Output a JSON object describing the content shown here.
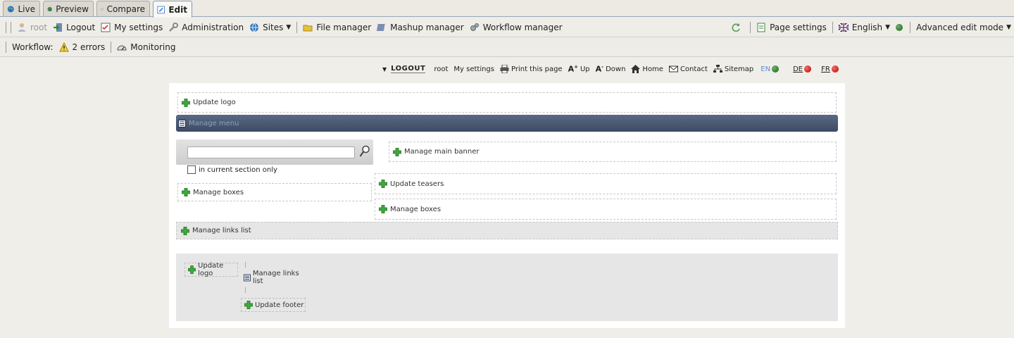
{
  "tabs": [
    {
      "label": "Live",
      "icon": "globe-icon"
    },
    {
      "label": "Preview",
      "icon": "preview-globe-icon"
    },
    {
      "label": "Compare",
      "icon": "compare-icon"
    },
    {
      "label": "Edit",
      "icon": "edit-icon",
      "active": true
    }
  ],
  "toolbar": {
    "user": "root",
    "logout": "Logout",
    "my_settings": "My settings",
    "administration": "Administration",
    "sites": "Sites",
    "file_manager": "File manager",
    "mashup_manager": "Mashup manager",
    "workflow_manager": "Workflow manager",
    "page_settings": "Page settings",
    "language": "English",
    "edit_mode": "Advanced edit mode"
  },
  "workflow": {
    "label": "Workflow:",
    "errors": "2 errors",
    "monitoring": "Monitoring"
  },
  "site_links": {
    "logout": "LOGOUT",
    "user": "root",
    "my_settings": "My settings",
    "print": "Print this page",
    "font_up": "Up",
    "font_down": "Down",
    "home": "Home",
    "contact": "Contact",
    "sitemap": "Sitemap",
    "languages": [
      {
        "code": "EN",
        "status": "green"
      },
      {
        "code": "DE",
        "status": "red"
      },
      {
        "code": "FR",
        "status": "red"
      }
    ]
  },
  "page": {
    "update_logo": "Update logo",
    "manage_menu": "Manage menu",
    "search_placeholder": "",
    "search_scope": "in current section only",
    "manage_main_banner": "Manage main banner",
    "manage_boxes_left": "Manage boxes",
    "update_teasers": "Update teasers",
    "manage_boxes_right": "Manage boxes",
    "manage_links_list": "Manage links list",
    "footer": {
      "update_logo": "Update logo",
      "manage_links_list": "Manage links list",
      "update_footer": "Update footer"
    }
  },
  "colors": {
    "accent": "#3d4a63",
    "background": "#f0eee8",
    "ok": "#2e7d2e",
    "error": "#c00000"
  }
}
